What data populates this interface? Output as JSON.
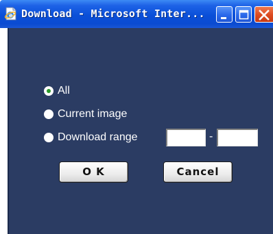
{
  "window": {
    "title": "Download - Microsoft Inter...",
    "app_icon": "internet-explorer-page-icon",
    "controls": {
      "minimize_icon": "minimize-icon",
      "maximize_icon": "maximize-icon",
      "close_icon": "close-icon"
    }
  },
  "colors": {
    "titlebar": "#0a4fd8",
    "background": "#2b3c63",
    "radio_selected_dot": "#2a9a2a",
    "close_button": "#dc4a20"
  },
  "options": {
    "all": {
      "label": "All",
      "selected": true
    },
    "current_image": {
      "label": "Current image",
      "selected": false
    },
    "download_range": {
      "label": "Download range",
      "selected": false,
      "from_value": "",
      "to_value": "",
      "separator": "-"
    }
  },
  "buttons": {
    "ok_label": "O K",
    "cancel_label": "Cancel"
  }
}
